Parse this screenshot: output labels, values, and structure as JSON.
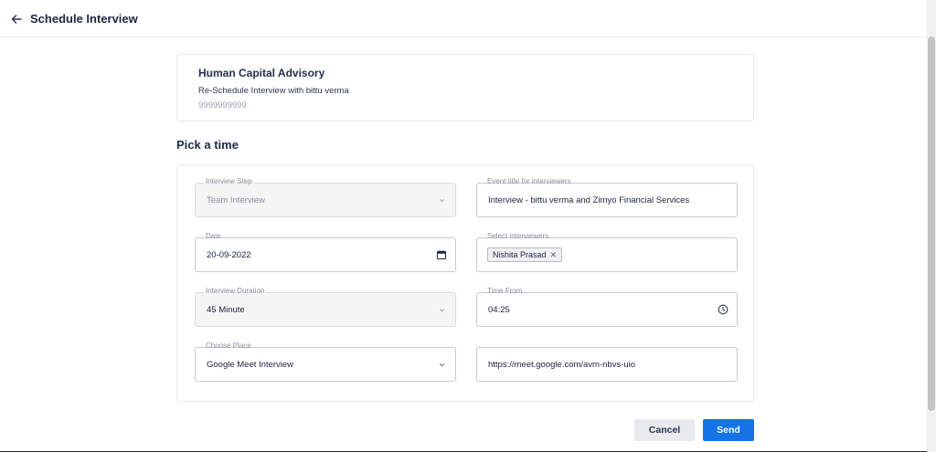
{
  "header": {
    "title": "Schedule Interview",
    "back_icon": "arrow-left-icon"
  },
  "summary": {
    "company": "Human Capital Advisory",
    "subtitle": "Re-Schedule Interview with bittu verma",
    "phone": "9999999999"
  },
  "section_title": "Pick a time",
  "form": {
    "interview_step": {
      "label": "Interview Step",
      "value": "Team Interview"
    },
    "event_title": {
      "label": "Event title for interviewers",
      "value": "Interview - bittu verma and Zimyo Financial Services"
    },
    "date": {
      "label": "Date",
      "value": "20-09-2022"
    },
    "interviewers": {
      "label": "Select interviewers",
      "chips": [
        "Nishita Prasad"
      ]
    },
    "duration": {
      "label": "Interview Duration",
      "value": "45 Minute"
    },
    "time_from": {
      "label": "Time From",
      "value": "04:25"
    },
    "place": {
      "label": "Choose Place",
      "value": "Google Meet Interview"
    },
    "meeting_link": {
      "value": "https://meet.google.com/avm-nbvs-uio"
    }
  },
  "actions": {
    "cancel_label": "Cancel",
    "send_label": "Send"
  },
  "colors": {
    "primary": "#1473e6",
    "title_text": "#1c2440",
    "muted_text": "#8a8f9c"
  }
}
